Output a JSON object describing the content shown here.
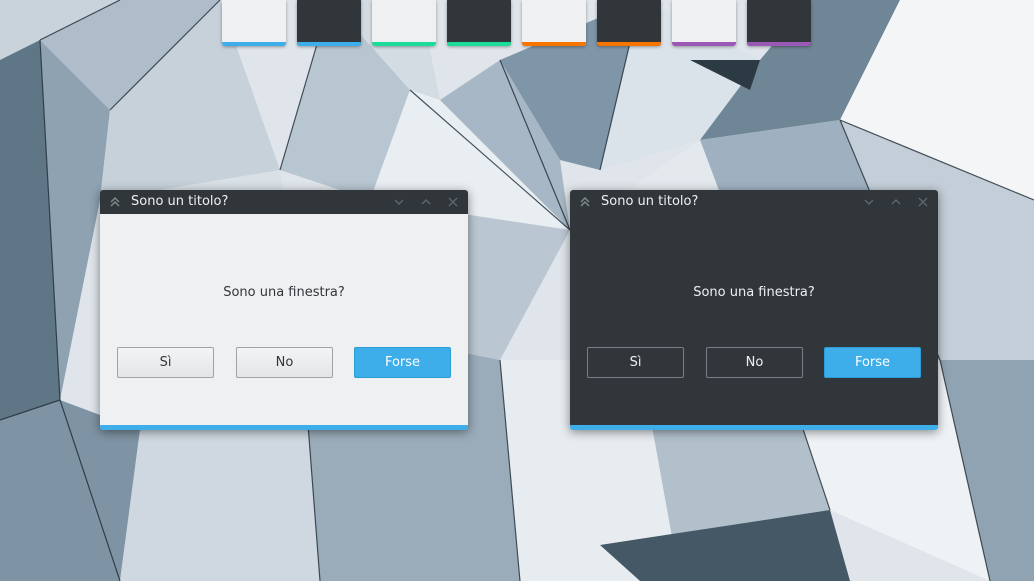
{
  "swatches": [
    {
      "base": "#eff0f1",
      "accent": "#3daee9"
    },
    {
      "base": "#31363b",
      "accent": "#3daee9"
    },
    {
      "base": "#eff0f1",
      "accent": "#1cdc9a"
    },
    {
      "base": "#31363b",
      "accent": "#1cdc9a"
    },
    {
      "base": "#eff0f1",
      "accent": "#f67400"
    },
    {
      "base": "#31363b",
      "accent": "#f67400"
    },
    {
      "base": "#eff0f1",
      "accent": "#9b59b6"
    },
    {
      "base": "#31363b",
      "accent": "#9b59b6"
    }
  ],
  "windows": {
    "light": {
      "title": "Sono un titolo?",
      "message": "Sono una finestra?",
      "buttons": {
        "yes": "Sì",
        "no": "No",
        "maybe": "Forse"
      },
      "accent": "#3daee9"
    },
    "dark": {
      "title": "Sono un titolo?",
      "message": "Sono una finestra?",
      "buttons": {
        "yes": "Sì",
        "no": "No",
        "maybe": "Forse"
      },
      "accent": "#3daee9"
    }
  },
  "icons": {
    "window_menu": "double-chevron-up-icon",
    "minimize": "chevron-down-icon",
    "maximize": "chevron-up-icon",
    "close": "close-icon"
  }
}
